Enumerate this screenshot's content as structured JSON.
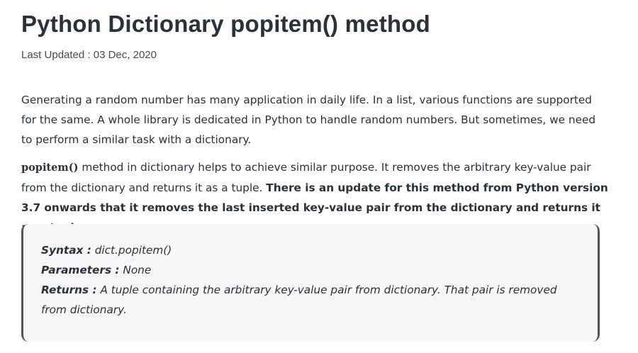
{
  "article": {
    "title": "Python Dictionary popitem() method",
    "last_updated": "Last Updated : 03 Dec, 2020",
    "paragraph1": "Generating a random number has many application in daily life. In a list, various functions are supported for the same. A whole library is dedicated in Python to handle random numbers. But sometimes, we need to perform a similar task with a dictionary.",
    "paragraph2": {
      "method_name": "popitem()",
      "text": " method in dictionary helps to achieve similar purpose. It removes the arbitrary key-value pair from the dictionary and returns it as a tuple. ",
      "bold_text": "There is an update for this method from Python version 3.7 onwards that it removes the last inserted key-value pair from the dictionary and returns it as a tuple."
    }
  },
  "syntax_box": {
    "syntax_label": "Syntax :",
    "syntax_value": " dict.popitem()",
    "parameters_label": "Parameters :",
    "parameters_value": " None",
    "returns_label": "Returns :",
    "returns_value": " A tuple containing the arbitrary key-value pair from dictionary. That pair is removed from dictionary."
  }
}
